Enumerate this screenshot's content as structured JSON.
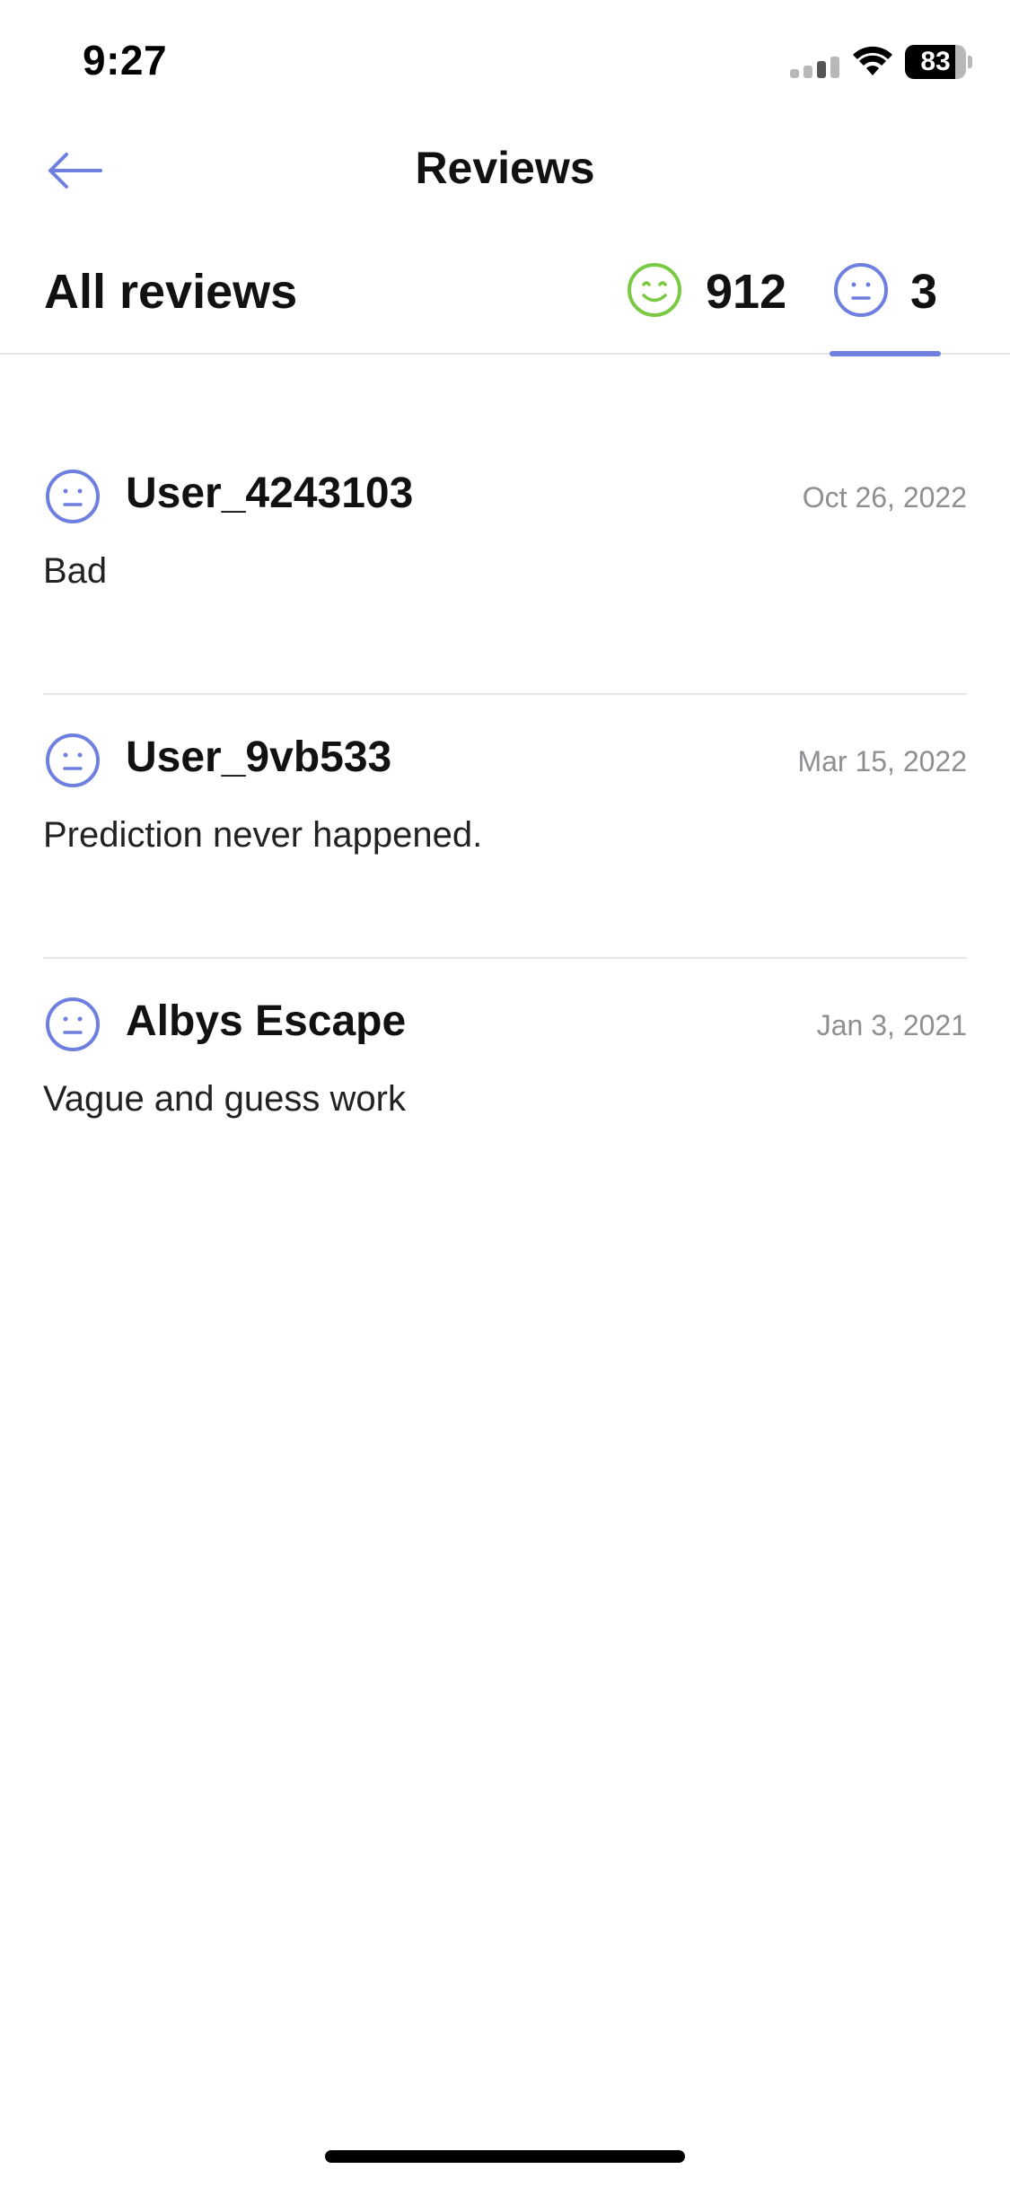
{
  "status_bar": {
    "time": "9:27",
    "battery_level": "83",
    "battery_fraction": 0.83
  },
  "nav": {
    "title": "Reviews",
    "back_icon": "arrow-left-icon"
  },
  "filter": {
    "title": "All reviews",
    "tabs": [
      {
        "icon": "smile-face-icon",
        "count": "912",
        "color": "#7ac943",
        "selected": false
      },
      {
        "icon": "neutral-face-icon",
        "count": "3",
        "color": "#6f7fe0",
        "selected": true
      }
    ]
  },
  "reviews": [
    {
      "user": "User_4243103",
      "date": "Oct 26, 2022",
      "text": "Bad",
      "icon": "neutral-face-icon"
    },
    {
      "user": "User_9vb533",
      "date": "Mar 15, 2022",
      "text": "Prediction never happened.",
      "icon": "neutral-face-icon"
    },
    {
      "user": "Albys Escape",
      "date": "Jan 3, 2021",
      "text": "Vague and guess work",
      "icon": "neutral-face-icon"
    }
  ],
  "colors": {
    "accent": "#6f7fe0",
    "positive": "#7ac943",
    "divider": "#e6e6e6",
    "muted_text": "#8e8e93"
  }
}
